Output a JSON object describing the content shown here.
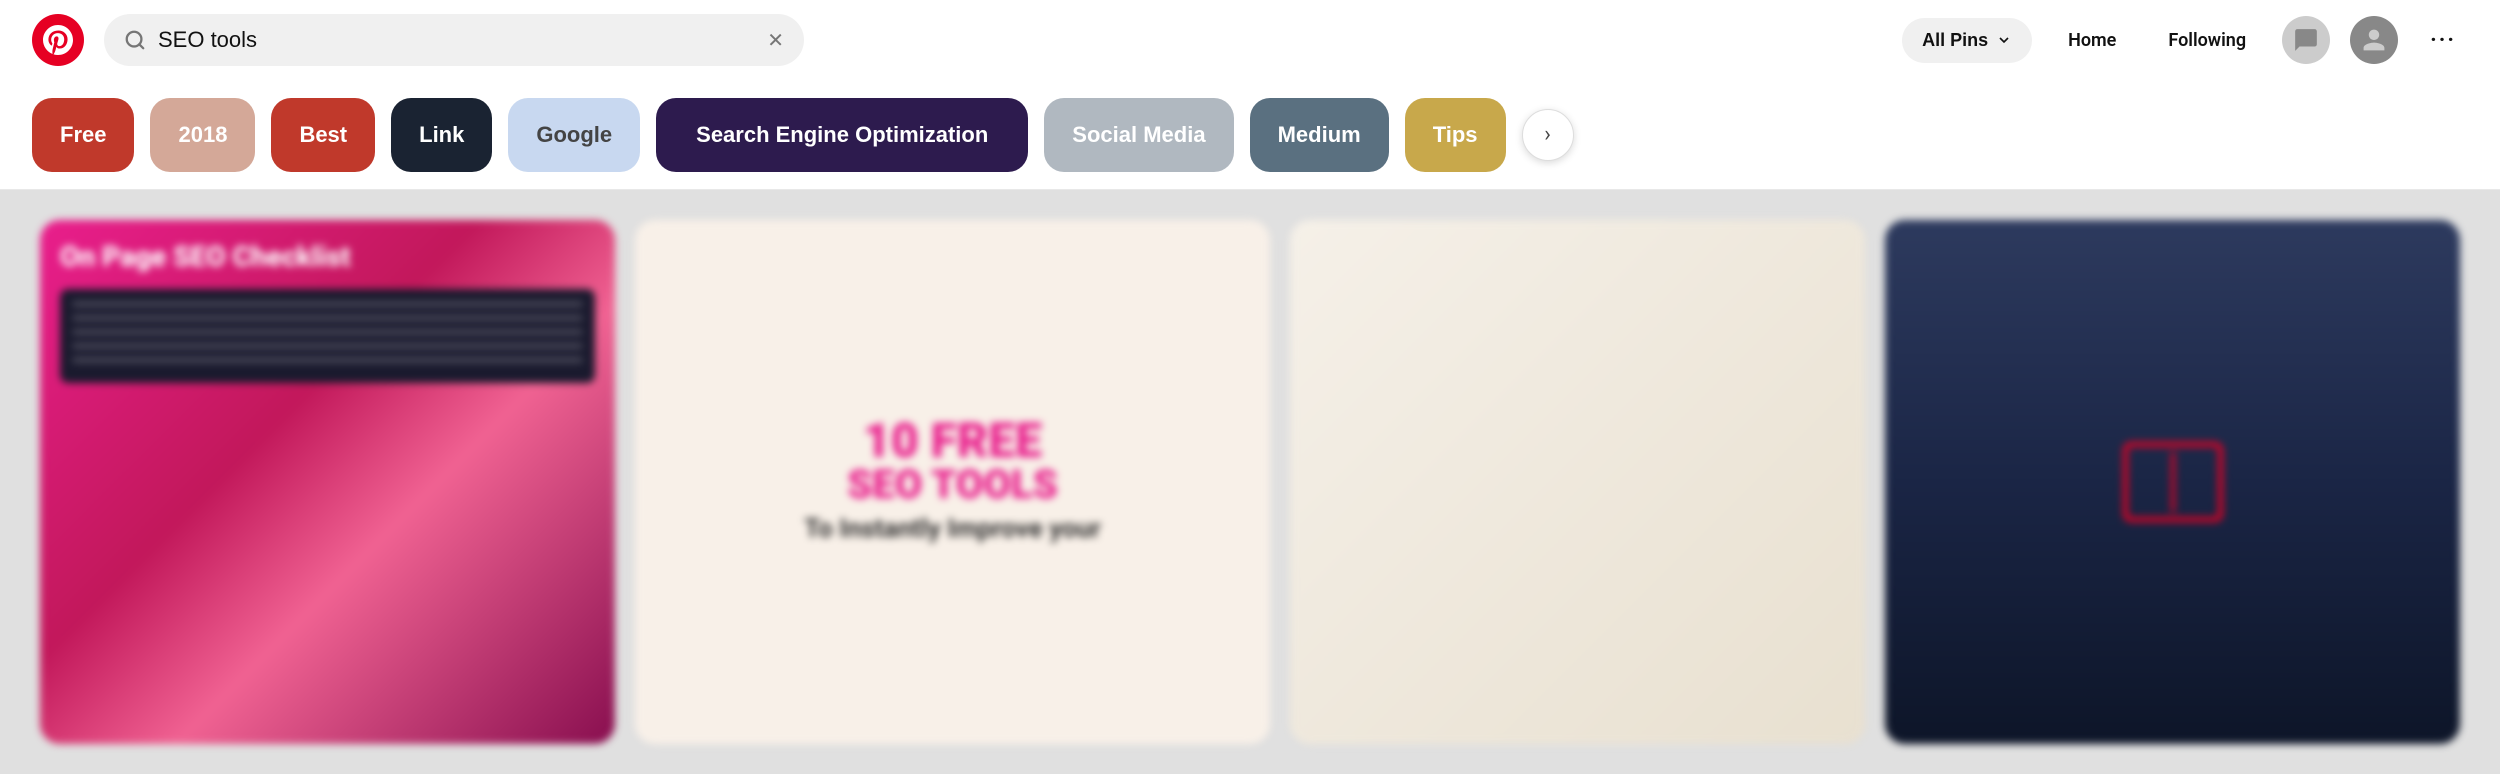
{
  "header": {
    "logo_label": "Pinterest",
    "search_value": "SEO tools",
    "search_placeholder": "Search",
    "all_pins_label": "All Pins",
    "nav_home": "Home",
    "nav_following": "Following",
    "more_label": "···"
  },
  "chips": [
    {
      "id": "free",
      "label": "Free",
      "class": "chip-free"
    },
    {
      "id": "2018",
      "label": "2018",
      "class": "chip-2018"
    },
    {
      "id": "best",
      "label": "Best",
      "class": "chip-best"
    },
    {
      "id": "link",
      "label": "Link",
      "class": "chip-link"
    },
    {
      "id": "google",
      "label": "Google",
      "class": "chip-google"
    },
    {
      "id": "seo",
      "label": "Search Engine Optimization",
      "class": "chip-seo"
    },
    {
      "id": "social-media",
      "label": "Social Media",
      "class": "chip-social"
    },
    {
      "id": "medium",
      "label": "Medium",
      "class": "chip-medium"
    },
    {
      "id": "tips",
      "label": "Tips",
      "class": "chip-tips"
    }
  ],
  "chips_next_icon": "›",
  "pins": [
    {
      "id": "pin-1",
      "title": "On Page SEO Checklist",
      "description": ""
    },
    {
      "id": "pin-2",
      "line1": "10  FREE",
      "line2": "SEO TOOLS",
      "line3": "To Instantly Improve your"
    },
    {
      "id": "pin-3",
      "description": ""
    },
    {
      "id": "pin-4",
      "description": ""
    }
  ]
}
